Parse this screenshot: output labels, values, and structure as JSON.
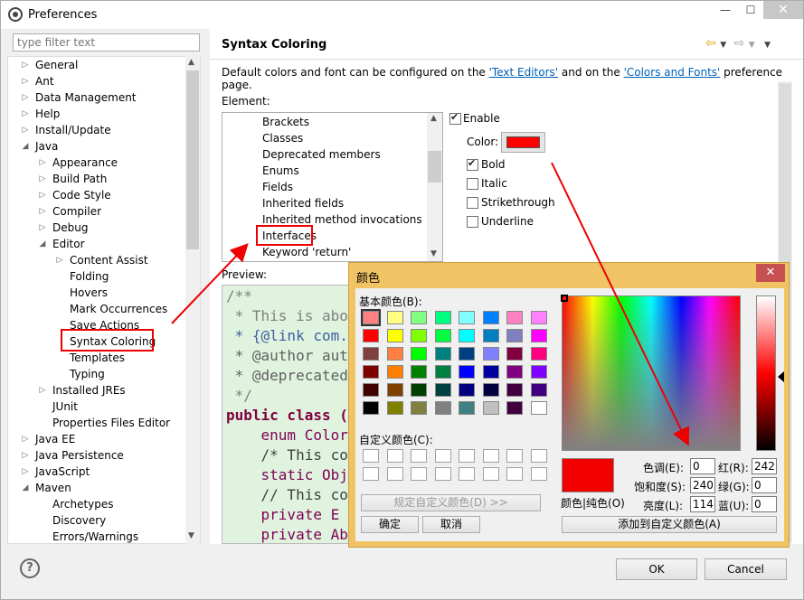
{
  "window": {
    "title": "Preferences"
  },
  "filter": {
    "placeholder": "type filter text"
  },
  "tree": [
    {
      "label": "General",
      "indent": 0,
      "arrow": "right"
    },
    {
      "label": "Ant",
      "indent": 0,
      "arrow": "right"
    },
    {
      "label": "Data Management",
      "indent": 0,
      "arrow": "right"
    },
    {
      "label": "Help",
      "indent": 0,
      "arrow": "right"
    },
    {
      "label": "Install/Update",
      "indent": 0,
      "arrow": "right"
    },
    {
      "label": "Java",
      "indent": 0,
      "arrow": "down"
    },
    {
      "label": "Appearance",
      "indent": 1,
      "arrow": "right"
    },
    {
      "label": "Build Path",
      "indent": 1,
      "arrow": "right"
    },
    {
      "label": "Code Style",
      "indent": 1,
      "arrow": "right"
    },
    {
      "label": "Compiler",
      "indent": 1,
      "arrow": "right"
    },
    {
      "label": "Debug",
      "indent": 1,
      "arrow": "right"
    },
    {
      "label": "Editor",
      "indent": 1,
      "arrow": "down"
    },
    {
      "label": "Content Assist",
      "indent": 2,
      "arrow": "right"
    },
    {
      "label": "Folding",
      "indent": 2,
      "arrow": ""
    },
    {
      "label": "Hovers",
      "indent": 2,
      "arrow": ""
    },
    {
      "label": "Mark Occurrences",
      "indent": 2,
      "arrow": ""
    },
    {
      "label": "Save Actions",
      "indent": 2,
      "arrow": ""
    },
    {
      "label": "Syntax Coloring",
      "indent": 2,
      "arrow": "",
      "selected": true
    },
    {
      "label": "Templates",
      "indent": 2,
      "arrow": ""
    },
    {
      "label": "Typing",
      "indent": 2,
      "arrow": ""
    },
    {
      "label": "Installed JREs",
      "indent": 1,
      "arrow": "right"
    },
    {
      "label": "JUnit",
      "indent": 1,
      "arrow": ""
    },
    {
      "label": "Properties Files Editor",
      "indent": 1,
      "arrow": ""
    },
    {
      "label": "Java EE",
      "indent": 0,
      "arrow": "right"
    },
    {
      "label": "Java Persistence",
      "indent": 0,
      "arrow": "right"
    },
    {
      "label": "JavaScript",
      "indent": 0,
      "arrow": "right"
    },
    {
      "label": "Maven",
      "indent": 0,
      "arrow": "down"
    },
    {
      "label": "Archetypes",
      "indent": 1,
      "arrow": ""
    },
    {
      "label": "Discovery",
      "indent": 1,
      "arrow": ""
    },
    {
      "label": "Errors/Warnings",
      "indent": 1,
      "arrow": ""
    }
  ],
  "page": {
    "title": "Syntax Coloring",
    "desc_pre": "Default colors and font can be configured on the ",
    "link1": "'Text Editors'",
    "desc_mid": " and on the ",
    "link2": "'Colors and Fonts'",
    "desc_post": " preference page.",
    "element_label": "Element:",
    "elements": [
      "Brackets",
      "Classes",
      "Deprecated members",
      "Enums",
      "Fields",
      "Inherited fields",
      "Inherited method invocations",
      "Interfaces",
      "Keyword 'return'"
    ],
    "enable_label": "Enable",
    "color_label": "Color:",
    "bold_label": "Bold",
    "italic_label": "Italic",
    "strike_label": "Strikethrough",
    "underline_label": "Underline",
    "preview_label": "Preview:",
    "preview_lines": [
      {
        "text": "/**",
        "color": "#808080"
      },
      {
        "text": " * This is abo",
        "color": "#808080"
      },
      {
        "text": " * {@link com.",
        "color": "#4060a0"
      },
      {
        "text": " * @author aut",
        "color": "#606060"
      },
      {
        "text": " * @deprecated",
        "color": "#606060"
      },
      {
        "text": " */",
        "color": "#808080"
      },
      {
        "text": "public class (",
        "color": "#800040",
        "bold": true
      },
      {
        "text": "    enum Color",
        "color": "#7f0055"
      },
      {
        "text": "    /* This co",
        "color": "#404040"
      },
      {
        "text": "    static Obj",
        "color": "#7f0055"
      },
      {
        "text": "    // This co",
        "color": "#404040"
      },
      {
        "text": "    private E",
        "color": "#7f0055"
      },
      {
        "text": "    private Ab",
        "color": "#7f0055"
      }
    ]
  },
  "buttons": {
    "ok": "OK",
    "cancel": "Cancel"
  },
  "color_dialog": {
    "title": "颜色",
    "basic_label": "基本颜色(B):",
    "custom_label": "自定义颜色(C):",
    "define_custom": "规定自定义颜色(D) >>",
    "ok": "确定",
    "cancel": "取消",
    "solid_label": "颜色|纯色(O)",
    "hue_label": "色调(E):",
    "hue_value": "0",
    "sat_label": "饱和度(S):",
    "sat_value": "240",
    "lum_label": "亮度(L):",
    "lum_value": "114",
    "red_label": "红(R):",
    "red_value": "242",
    "green_label": "绿(G):",
    "green_value": "0",
    "blue_label": "蓝(U):",
    "blue_value": "0",
    "add_custom": "添加到自定义颜色(A)",
    "basic_colors": [
      "#ff8080",
      "#ffff80",
      "#80ff80",
      "#00ff80",
      "#80ffff",
      "#0080ff",
      "#ff80c0",
      "#ff80ff",
      "#ff0000",
      "#ffff00",
      "#80ff00",
      "#00ff40",
      "#00ffff",
      "#0080c0",
      "#8080c0",
      "#ff00ff",
      "#804040",
      "#ff8040",
      "#00ff00",
      "#008080",
      "#004080",
      "#8080ff",
      "#800040",
      "#ff0080",
      "#800000",
      "#ff8000",
      "#008000",
      "#008040",
      "#0000ff",
      "#0000a0",
      "#800080",
      "#8000ff",
      "#400000",
      "#804000",
      "#004000",
      "#004040",
      "#000080",
      "#000040",
      "#400040",
      "#400080",
      "#000000",
      "#808000",
      "#808040",
      "#808080",
      "#408080",
      "#c0c0c0",
      "#400040",
      "#ffffff"
    ]
  }
}
